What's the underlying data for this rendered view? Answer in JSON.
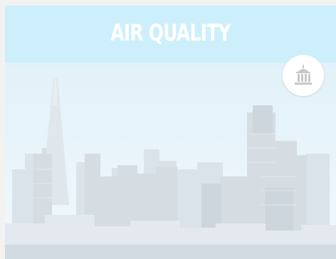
{
  "card": {
    "title": "AIR QUALITY"
  },
  "badge": {
    "icon": "government-building-icon"
  },
  "photo": {
    "subject": "city-skyline-image"
  },
  "colors": {
    "header_bg": "#cdeffb",
    "title_text": "#ffffff",
    "badge_bg": "#ffffff",
    "icon_color": "#c8c8c8"
  }
}
